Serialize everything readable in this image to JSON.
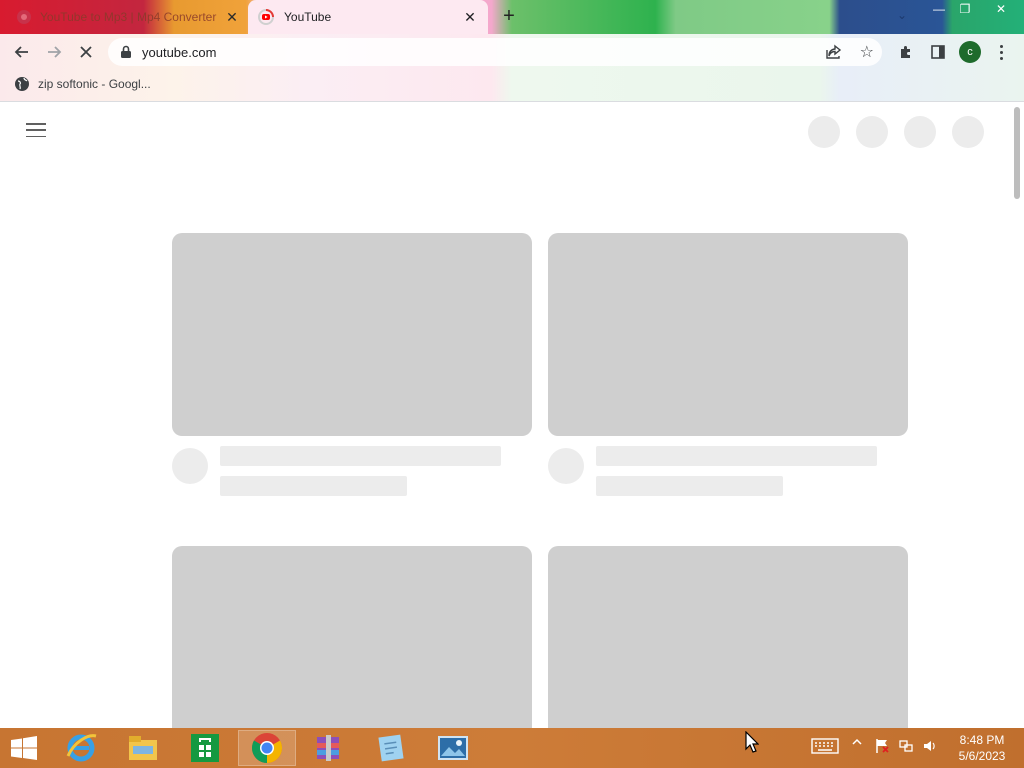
{
  "browser": {
    "tabs": [
      {
        "label": "YouTube to Mp3 | Mp4 Converter",
        "active": false,
        "favicon": "red-globe-icon"
      },
      {
        "label": "YouTube",
        "active": true,
        "favicon": "youtube-icon"
      }
    ],
    "new_tab_symbol": "+",
    "close_symbol": "✕",
    "url": "youtube.com",
    "profile_initial": "c",
    "bookmarks": [
      {
        "label": "zip softonic - Googl...",
        "icon": "globe-icon"
      }
    ],
    "window_controls": {
      "minimize": "—",
      "restore": "❐",
      "close": "✕"
    }
  },
  "page": {
    "app": "YouTube",
    "state": "loading-skeleton",
    "header_placeholders": 4,
    "video_placeholder_rows": 2,
    "video_placeholder_columns": 2
  },
  "taskbar": {
    "apps": [
      {
        "name": "start-button"
      },
      {
        "name": "internet-explorer"
      },
      {
        "name": "file-explorer"
      },
      {
        "name": "windows-store"
      },
      {
        "name": "google-chrome",
        "active": true
      },
      {
        "name": "winrar"
      },
      {
        "name": "notepad"
      },
      {
        "name": "photo-viewer"
      }
    ],
    "time": "8:48 PM",
    "date": "5/6/2023"
  },
  "colors": {
    "skeleton_thumb": "#cfcfcf",
    "skeleton_line": "#ececec",
    "taskbar": "#c77532",
    "profile_avatar": "#1e6b2c"
  }
}
